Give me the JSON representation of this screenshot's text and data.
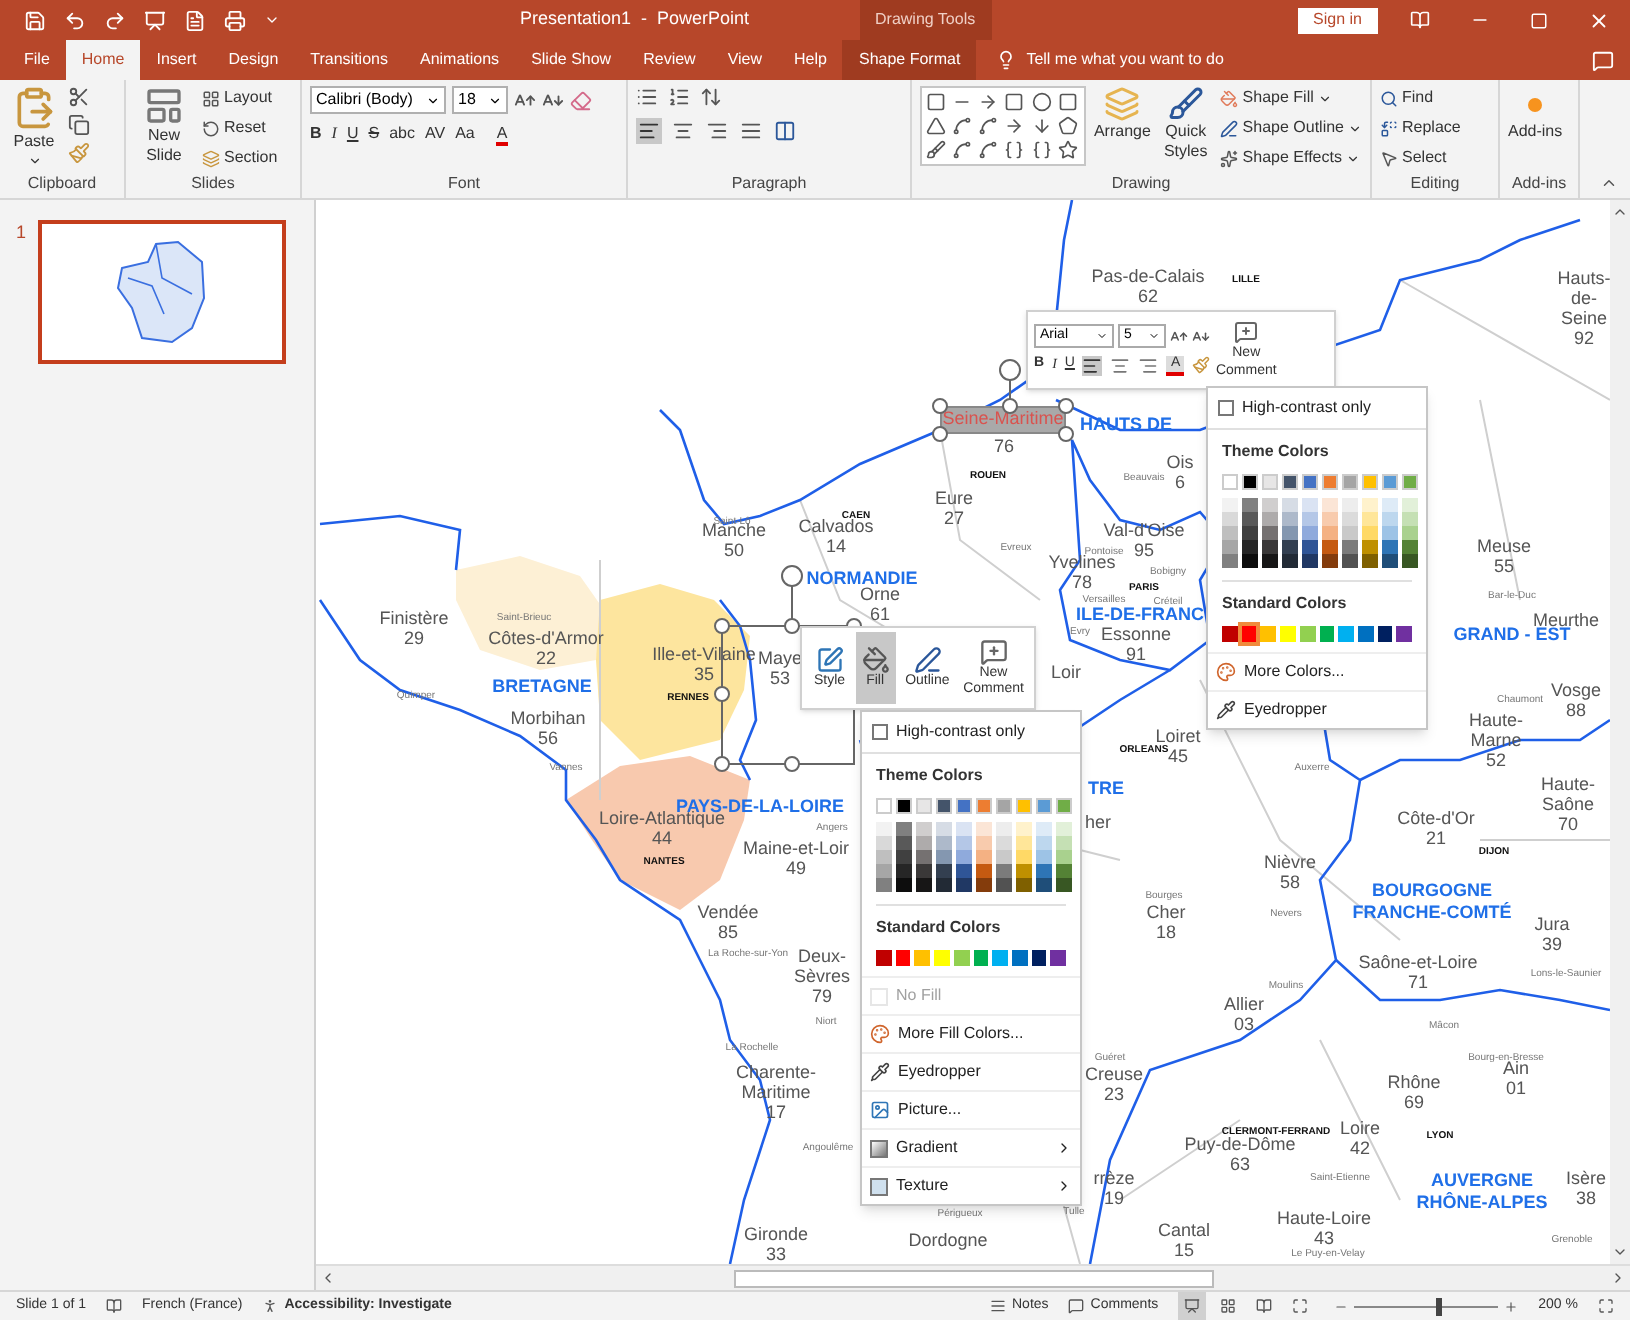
{
  "title_bar": {
    "title": "Presentation1  -  PowerPoint",
    "context_label": "Drawing Tools",
    "sign_in": "Sign in"
  },
  "tabs": [
    {
      "label": "File",
      "selected": false,
      "kind": "plain"
    },
    {
      "label": "Home",
      "selected": true,
      "kind": "plain"
    },
    {
      "label": "Insert",
      "selected": false,
      "kind": "plain"
    },
    {
      "label": "Design",
      "selected": false,
      "kind": "plain"
    },
    {
      "label": "Transitions",
      "selected": false,
      "kind": "plain"
    },
    {
      "label": "Animations",
      "selected": false,
      "kind": "plain"
    },
    {
      "label": "Slide Show",
      "selected": false,
      "kind": "plain"
    },
    {
      "label": "Review",
      "selected": false,
      "kind": "plain"
    },
    {
      "label": "View",
      "selected": false,
      "kind": "plain"
    },
    {
      "label": "Help",
      "selected": false,
      "kind": "plain"
    },
    {
      "label": "Shape Format",
      "selected": false,
      "kind": "contextual"
    }
  ],
  "tell_me": "Tell me what you want to do",
  "ribbon": {
    "groups": [
      {
        "kind": "clipboard",
        "label": "Clipboard",
        "button": "Paste"
      },
      {
        "kind": "slides",
        "label": "Slides",
        "button": "New Slide",
        "items": [
          "Layout",
          "Reset",
          "Section"
        ]
      },
      {
        "kind": "font",
        "label": "Font",
        "font": "Calibri (Body)",
        "size": "18",
        "format_buttons": [
          "B",
          "I",
          "U",
          "S",
          "abc",
          "AV",
          "Aa"
        ],
        "font_color": "A"
      },
      {
        "kind": "paragraph",
        "label": "Paragraph",
        "alignments": [
          {
            "selected": true
          },
          {
            "selected": false
          },
          {
            "selected": false
          },
          {
            "selected": false
          }
        ]
      },
      {
        "kind": "drawing",
        "label": "Drawing",
        "arrange": "Arrange",
        "quick_styles": "Quick Styles",
        "items": [
          "Shape Fill",
          "Shape Outline",
          "Shape Effects"
        ]
      },
      {
        "kind": "editing",
        "label": "Editing",
        "items": [
          "Find",
          "Replace",
          "Select"
        ]
      },
      {
        "kind": "addins",
        "label": "Add-ins",
        "button": "Add-ins"
      }
    ]
  },
  "slides_pane": {
    "slides": [
      {
        "number": "1",
        "selected": true
      }
    ]
  },
  "map": {
    "selected_label": {
      "name": "Seine-Maritime",
      "number": "76"
    },
    "departments": [
      {
        "name": "Pas-de-Calais",
        "number": "62"
      },
      {
        "name": "Hauts-de-Seine",
        "number": "92"
      },
      {
        "name": "Eure",
        "number": "27"
      },
      {
        "name": "Manche",
        "number": "50"
      },
      {
        "name": "Calvados",
        "number": "14"
      },
      {
        "name": "Ois",
        "number": "6"
      },
      {
        "name": "Val-d'Oise",
        "number": "95"
      },
      {
        "name": "Yvelines",
        "number": "78"
      },
      {
        "name": "Essonne",
        "number": "91"
      },
      {
        "name": "Orne",
        "number": "61"
      },
      {
        "name": "Maye",
        "number": "53"
      },
      {
        "name": "Finistère",
        "number": "29"
      },
      {
        "name": "Côtes-d'Armor",
        "number": "22"
      },
      {
        "name": "Ille-et-Vilaine",
        "number": "35"
      },
      {
        "name": "Morbihan",
        "number": "56"
      },
      {
        "name": "Loire-Atlantique",
        "number": "44"
      },
      {
        "name": "Maine-et-Loir",
        "number": "49"
      },
      {
        "name": "Vendée",
        "number": "85"
      },
      {
        "name": "Deux-Sèvres",
        "number": "79"
      },
      {
        "name": "Charente-Maritime",
        "number": "17"
      },
      {
        "name": "Gironde",
        "number": "33"
      },
      {
        "name": "Dordogne"
      },
      {
        "name": "Loir"
      },
      {
        "name": "Loiret",
        "number": "45"
      },
      {
        "name": "Cher",
        "number": "18"
      },
      {
        "name": "Nièvre",
        "number": "58"
      },
      {
        "name": "Allier",
        "number": "03"
      },
      {
        "name": "Creuse",
        "number": "23"
      },
      {
        "name": "rrèze",
        "number": "19"
      },
      {
        "name": "Puy-de-Dôme",
        "number": "63"
      },
      {
        "name": "Cantal",
        "number": "15"
      },
      {
        "name": "Haute-Loire",
        "number": "43"
      },
      {
        "name": "Loire",
        "number": "42"
      },
      {
        "name": "Rhône",
        "number": "69"
      },
      {
        "name": "Ain",
        "number": "01"
      },
      {
        "name": "Isère",
        "number": "38"
      },
      {
        "name": "Jura",
        "number": "39"
      },
      {
        "name": "Côte-d'Or",
        "number": "21"
      },
      {
        "name": "Saône-et-Loire",
        "number": "71"
      },
      {
        "name": "Haute-Saône",
        "number": "70"
      },
      {
        "name": "Haute-Marne",
        "number": "52"
      },
      {
        "name": "Vosge",
        "number": "88"
      },
      {
        "name": "Meuse",
        "number": "55"
      },
      {
        "name": "Meurthe"
      },
      {
        "name": "her"
      }
    ],
    "regions": [
      "HAUTS DE",
      "NORMANDIE",
      "ILE-DE-FRANC",
      "BRETAGNE",
      "PAYS-DE-LA-LOIRE",
      "TRE",
      "GRAND - EST",
      "BOURGOGNE FRANCHE-COMTÉ",
      "AUVERGNE RHÔNE-ALPES"
    ],
    "cities": [
      {
        "name": "LILLE",
        "capital": true
      },
      {
        "name": "ROUEN",
        "capital": true
      },
      {
        "name": "CAEN",
        "capital": true
      },
      {
        "name": "Saint-Lô",
        "capital": false
      },
      {
        "name": "Beauvais",
        "capital": false
      },
      {
        "name": "Evreux",
        "capital": false
      },
      {
        "name": "Pontoise",
        "capital": false
      },
      {
        "name": "PARIS",
        "capital": true
      },
      {
        "name": "Bobigny",
        "capital": false
      },
      {
        "name": "Versailles",
        "capital": false
      },
      {
        "name": "Créteil",
        "capital": false
      },
      {
        "name": "Evry",
        "capital": false
      },
      {
        "name": "Saint-Brieuc",
        "capital": false
      },
      {
        "name": "Quimper",
        "capital": false
      },
      {
        "name": "Vannes",
        "capital": false
      },
      {
        "name": "RENNES",
        "capital": true
      },
      {
        "name": "NANTES",
        "capital": true
      },
      {
        "name": "Angers",
        "capital": false
      },
      {
        "name": "La Roche-sur-Yon",
        "capital": false
      },
      {
        "name": "Niort",
        "capital": false
      },
      {
        "name": "La Rochelle",
        "capital": false
      },
      {
        "name": "Angoulême",
        "capital": false
      },
      {
        "name": "Périgueux",
        "capital": false
      },
      {
        "name": "Tulle",
        "capital": false
      },
      {
        "name": "Guéret",
        "capital": false
      },
      {
        "name": "ORLEANS",
        "capital": true
      },
      {
        "name": "Bourges",
        "capital": false
      },
      {
        "name": "Nevers",
        "capital": false
      },
      {
        "name": "Moulins",
        "capital": false
      },
      {
        "name": "CLERMONT-FERRAND",
        "capital": true
      },
      {
        "name": "Saint-Etienne",
        "capital": false
      },
      {
        "name": "Le Puy-en-Velay",
        "capital": false
      },
      {
        "name": "LYON",
        "capital": true
      },
      {
        "name": "Mâcon",
        "capital": false
      },
      {
        "name": "Bourg-en-Bresse",
        "capital": false
      },
      {
        "name": "Lons-le-Saunier",
        "capital": false
      },
      {
        "name": "Bar-le-Duc",
        "capital": false
      },
      {
        "name": "Chaumont",
        "capital": false
      },
      {
        "name": "DIJON",
        "capital": true
      },
      {
        "name": "Auxerre",
        "capital": false
      },
      {
        "name": "Grenoble",
        "capital": false
      }
    ]
  },
  "text_toolbar": {
    "font": "Arial",
    "size": "5",
    "format_buttons": [
      "B",
      "I",
      "U"
    ],
    "alignments": [
      {
        "selected": true
      },
      {
        "selected": false
      },
      {
        "selected": false
      }
    ],
    "font_color": "A",
    "new_comment": "New Comment"
  },
  "font_color_menu": {
    "high_contrast": {
      "label": "High-contrast only",
      "checked": false
    },
    "theme_title": "Theme Colors",
    "theme_colors": [
      {
        "color": "#ffffff",
        "shades": [
          {
            "color": "#f2f2f2"
          },
          {
            "color": "#d9d9d9"
          },
          {
            "color": "#bfbfbf"
          },
          {
            "color": "#a6a6a6"
          },
          {
            "color": "#808080"
          }
        ]
      },
      {
        "color": "#000000",
        "shades": [
          {
            "color": "#808080"
          },
          {
            "color": "#595959"
          },
          {
            "color": "#404040"
          },
          {
            "color": "#262626"
          },
          {
            "color": "#0d0d0d"
          }
        ]
      },
      {
        "color": "#e7e6e6",
        "shades": [
          {
            "color": "#d0cece"
          },
          {
            "color": "#aeabab"
          },
          {
            "color": "#757171"
          },
          {
            "color": "#3a3838"
          },
          {
            "color": "#171616"
          }
        ]
      },
      {
        "color": "#44546a",
        "shades": [
          {
            "color": "#d6dce5"
          },
          {
            "color": "#adb9ca"
          },
          {
            "color": "#8497b0"
          },
          {
            "color": "#333f50"
          },
          {
            "color": "#222a35"
          }
        ]
      },
      {
        "color": "#4472c4",
        "shades": [
          {
            "color": "#dae3f3"
          },
          {
            "color": "#b4c7e7"
          },
          {
            "color": "#8faadc"
          },
          {
            "color": "#2f5597"
          },
          {
            "color": "#203864"
          }
        ]
      },
      {
        "color": "#ed7d31",
        "shades": [
          {
            "color": "#fbe5d6"
          },
          {
            "color": "#f8cbad"
          },
          {
            "color": "#f4b183"
          },
          {
            "color": "#c55a11"
          },
          {
            "color": "#843c0c"
          }
        ]
      },
      {
        "color": "#a5a5a5",
        "shades": [
          {
            "color": "#ededed"
          },
          {
            "color": "#dbdbdb"
          },
          {
            "color": "#c9c9c9"
          },
          {
            "color": "#7b7b7b"
          },
          {
            "color": "#525252"
          }
        ]
      },
      {
        "color": "#ffc000",
        "shades": [
          {
            "color": "#fff2cc"
          },
          {
            "color": "#ffe699"
          },
          {
            "color": "#ffd966"
          },
          {
            "color": "#bf9000"
          },
          {
            "color": "#7f6000"
          }
        ]
      },
      {
        "color": "#5b9bd5",
        "shades": [
          {
            "color": "#deebf7"
          },
          {
            "color": "#bdd7ee"
          },
          {
            "color": "#9dc3e6"
          },
          {
            "color": "#2e75b6"
          },
          {
            "color": "#1f4e79"
          }
        ]
      },
      {
        "color": "#70ad47",
        "shades": [
          {
            "color": "#e2f0d9"
          },
          {
            "color": "#c5e0b4"
          },
          {
            "color": "#a9d18e"
          },
          {
            "color": "#548235"
          },
          {
            "color": "#385723"
          }
        ]
      }
    ],
    "standard_title": "Standard Colors",
    "standard_colors": [
      {
        "color": "#c00000",
        "selected": false
      },
      {
        "color": "#ff0000",
        "selected": true
      },
      {
        "color": "#ffc000",
        "selected": false
      },
      {
        "color": "#ffff00",
        "selected": false
      },
      {
        "color": "#92d050",
        "selected": false
      },
      {
        "color": "#00b050",
        "selected": false
      },
      {
        "color": "#00b0f0",
        "selected": false
      },
      {
        "color": "#0070c0",
        "selected": false
      },
      {
        "color": "#002060",
        "selected": false
      },
      {
        "color": "#7030a0",
        "selected": false
      }
    ],
    "items": [
      {
        "label": "More Colors...",
        "kind": "palette",
        "disabled": false,
        "submenu": false
      },
      {
        "label": "Eyedropper",
        "kind": "eyedropper",
        "disabled": false,
        "submenu": false
      }
    ]
  },
  "shape_toolbar": {
    "buttons": [
      {
        "label": "Style",
        "kind": "style",
        "selected": false
      },
      {
        "label": "Fill",
        "kind": "fill",
        "selected": true
      },
      {
        "label": "Outline",
        "kind": "outline",
        "selected": false
      },
      {
        "label": "New Comment",
        "kind": "comment",
        "selected": false
      }
    ]
  },
  "fill_menu": {
    "high_contrast": {
      "label": "High-contrast only",
      "checked": false
    },
    "theme_title": "Theme Colors",
    "theme_colors": [
      {
        "color": "#ffffff",
        "shades": [
          {
            "color": "#f2f2f2"
          },
          {
            "color": "#d9d9d9"
          },
          {
            "color": "#bfbfbf"
          },
          {
            "color": "#a6a6a6"
          },
          {
            "color": "#808080"
          }
        ]
      },
      {
        "color": "#000000",
        "shades": [
          {
            "color": "#808080"
          },
          {
            "color": "#595959"
          },
          {
            "color": "#404040"
          },
          {
            "color": "#262626"
          },
          {
            "color": "#0d0d0d"
          }
        ]
      },
      {
        "color": "#e7e6e6",
        "shades": [
          {
            "color": "#d0cece"
          },
          {
            "color": "#aeabab"
          },
          {
            "color": "#757171"
          },
          {
            "color": "#3a3838"
          },
          {
            "color": "#171616"
          }
        ]
      },
      {
        "color": "#44546a",
        "shades": [
          {
            "color": "#d6dce5"
          },
          {
            "color": "#adb9ca"
          },
          {
            "color": "#8497b0"
          },
          {
            "color": "#333f50"
          },
          {
            "color": "#222a35"
          }
        ]
      },
      {
        "color": "#4472c4",
        "shades": [
          {
            "color": "#dae3f3"
          },
          {
            "color": "#b4c7e7"
          },
          {
            "color": "#8faadc"
          },
          {
            "color": "#2f5597"
          },
          {
            "color": "#203864"
          }
        ]
      },
      {
        "color": "#ed7d31",
        "shades": [
          {
            "color": "#fbe5d6"
          },
          {
            "color": "#f8cbad"
          },
          {
            "color": "#f4b183"
          },
          {
            "color": "#c55a11"
          },
          {
            "color": "#843c0c"
          }
        ]
      },
      {
        "color": "#a5a5a5",
        "shades": [
          {
            "color": "#ededed"
          },
          {
            "color": "#dbdbdb"
          },
          {
            "color": "#c9c9c9"
          },
          {
            "color": "#7b7b7b"
          },
          {
            "color": "#525252"
          }
        ]
      },
      {
        "color": "#ffc000",
        "shades": [
          {
            "color": "#fff2cc"
          },
          {
            "color": "#ffe699"
          },
          {
            "color": "#ffd966"
          },
          {
            "color": "#bf9000"
          },
          {
            "color": "#7f6000"
          }
        ]
      },
      {
        "color": "#5b9bd5",
        "shades": [
          {
            "color": "#deebf7"
          },
          {
            "color": "#bdd7ee"
          },
          {
            "color": "#9dc3e6"
          },
          {
            "color": "#2e75b6"
          },
          {
            "color": "#1f4e79"
          }
        ]
      },
      {
        "color": "#70ad47",
        "shades": [
          {
            "color": "#e2f0d9"
          },
          {
            "color": "#c5e0b4"
          },
          {
            "color": "#a9d18e"
          },
          {
            "color": "#548235"
          },
          {
            "color": "#385723"
          }
        ]
      }
    ],
    "standard_title": "Standard Colors",
    "standard_colors": [
      {
        "color": "#c00000",
        "selected": false
      },
      {
        "color": "#ff0000",
        "selected": false
      },
      {
        "color": "#ffc000",
        "selected": false
      },
      {
        "color": "#ffff00",
        "selected": false
      },
      {
        "color": "#92d050",
        "selected": false
      },
      {
        "color": "#00b050",
        "selected": false
      },
      {
        "color": "#00b0f0",
        "selected": false
      },
      {
        "color": "#0070c0",
        "selected": false
      },
      {
        "color": "#002060",
        "selected": false
      },
      {
        "color": "#7030a0",
        "selected": false
      }
    ],
    "items": [
      {
        "label": "No Fill",
        "kind": "none",
        "disabled": true,
        "submenu": false
      },
      {
        "label": "More Fill Colors...",
        "kind": "palette",
        "disabled": false,
        "submenu": false
      },
      {
        "label": "Eyedropper",
        "kind": "eyedropper",
        "disabled": false,
        "submenu": false
      },
      {
        "label": "Picture...",
        "kind": "picture",
        "disabled": false,
        "submenu": false
      },
      {
        "label": "Gradient",
        "kind": "gradient",
        "disabled": false,
        "submenu": true
      },
      {
        "label": "Texture",
        "kind": "texture",
        "disabled": false,
        "submenu": true
      }
    ]
  },
  "status_bar": {
    "slide": "Slide 1 of 1",
    "language": "French (France)",
    "accessibility": "Accessibility: Investigate",
    "notes": "Notes",
    "comments": "Comments",
    "views": [
      {
        "selected": true
      },
      {
        "selected": false
      },
      {
        "selected": false
      },
      {
        "selected": false
      }
    ],
    "zoom": {
      "level": 0.57
    },
    "zoom_text": "200 %"
  }
}
